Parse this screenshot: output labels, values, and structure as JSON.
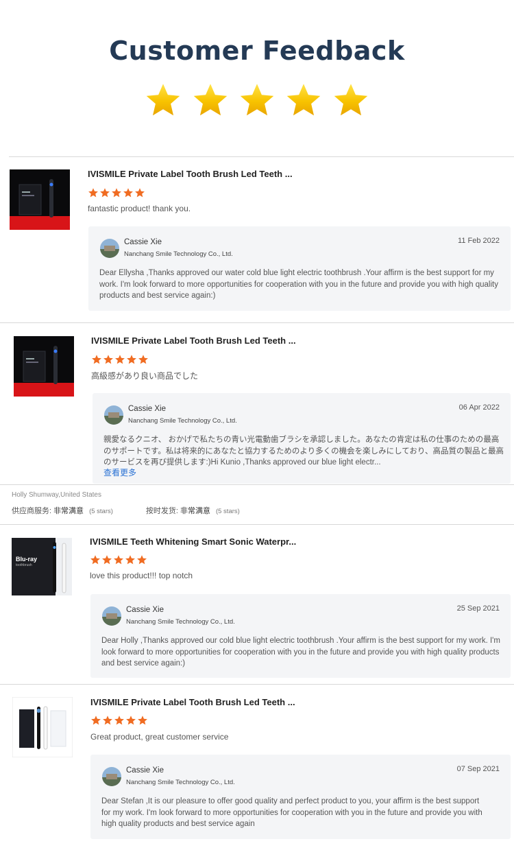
{
  "header": {
    "title": "Customer Feedback",
    "rating_stars": 5
  },
  "colors": {
    "title": "#243a55",
    "review_star": "#f06c22",
    "hero_star": "#f5c400",
    "link": "#2a72d4"
  },
  "reviews": [
    {
      "product_title": "IVISMILE Private Label Tooth Brush Led Teeth ...",
      "rating": 5,
      "comment": "fantastic product! thank you.",
      "reply": {
        "name": "Cassie Xie",
        "company": "Nanchang Smile Technology Co., Ltd.",
        "date": "11 Feb 2022",
        "text": "Dear Ellysha ,Thanks  approved our water cold blue light electric toothbrush .Your affirm is the best support for my work. I'm look forward to more opportunities for cooperation with you in the future and provide you with high quality products and best service again:)"
      }
    },
    {
      "product_title": "IVISMILE Private Label Tooth Brush Led Teeth ...",
      "rating": 5,
      "comment": "高級感があり良い商品でした",
      "reply": {
        "name": "Cassie Xie",
        "company": "Nanchang Smile Technology Co., Ltd.",
        "date": "06 Apr 2022",
        "text": "親愛なるクニオ、 おかげで私たちの青い光電動歯ブラシを承認しました。あなたの肯定は私の仕事のための最高のサポートです。私は将来的にあなたと協力するためのより多くの機会を楽しみにしており、高品質の製品と最高のサービスを再び提供します:)Hi  Kunio ,Thanks approved our blue light electr...",
        "see_more": "查看更多"
      }
    },
    {
      "product_title": "IVISMILE Teeth Whitening Smart Sonic Waterpr...",
      "rating": 5,
      "comment": "love this product!!! top notch",
      "thumb_brand": "Blu-ray",
      "thumb_sub": "toothbrush",
      "reply": {
        "name": "Cassie Xie",
        "company": "Nanchang Smile Technology Co., Ltd.",
        "date": "25 Sep 2021",
        "text": "Dear Holly ,Thanks  approved our cold blue light electric toothbrush .Your affirm is the best support for my work. I'm look forward to more opportunities for cooperation with you in the future and provide you with high quality products and best service again:)"
      }
    },
    {
      "product_title": "IVISMILE Private Label Tooth Brush Led Teeth ...",
      "rating": 5,
      "comment": "Great product, great customer service",
      "reply": {
        "name": "Cassie Xie",
        "company": "Nanchang Smile Technology Co., Ltd.",
        "date": "07 Sep 2021",
        "text": "Dear Stefan ,It is our pleasure to offer good quality and perfect product to you, your affirm is the best support for my work. I'm look forward to more opportunities for cooperation with you in the future and provide you with high quality products and best service  again"
      }
    }
  ],
  "buyer_meta": {
    "author": "Holly Shumway,United States",
    "supplier_service_label": "供应商服务:",
    "supplier_service_value": "非常满意",
    "supplier_service_count": "(5 stars)",
    "on_time_label": "按时发货:",
    "on_time_value": "非常满意",
    "on_time_count": "(5 stars)"
  }
}
